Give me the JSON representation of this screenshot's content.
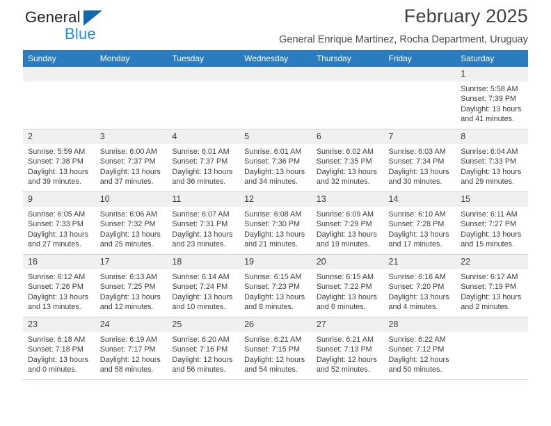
{
  "brand": {
    "name_part1": "General",
    "name_part2": "Blue",
    "logo_icon": "triangle-icon",
    "accent_dark": "#1269b0",
    "accent_light": "#1f8ae0"
  },
  "header": {
    "title": "February 2025",
    "subtitle": "General Enrique Martinez, Rocha Department, Uruguay"
  },
  "calendar": {
    "header_bg": "#2b7cbf",
    "daynum_bg": "#f0f0f0",
    "weekdays": [
      "Sunday",
      "Monday",
      "Tuesday",
      "Wednesday",
      "Thursday",
      "Friday",
      "Saturday"
    ],
    "weeks": [
      [
        {
          "day": "",
          "empty": true
        },
        {
          "day": "",
          "empty": true
        },
        {
          "day": "",
          "empty": true
        },
        {
          "day": "",
          "empty": true
        },
        {
          "day": "",
          "empty": true
        },
        {
          "day": "",
          "empty": true
        },
        {
          "day": "1",
          "sunrise": "Sunrise: 5:58 AM",
          "sunset": "Sunset: 7:39 PM",
          "daylight1": "Daylight: 13 hours",
          "daylight2": "and 41 minutes."
        }
      ],
      [
        {
          "day": "2",
          "sunrise": "Sunrise: 5:59 AM",
          "sunset": "Sunset: 7:38 PM",
          "daylight1": "Daylight: 13 hours",
          "daylight2": "and 39 minutes."
        },
        {
          "day": "3",
          "sunrise": "Sunrise: 6:00 AM",
          "sunset": "Sunset: 7:37 PM",
          "daylight1": "Daylight: 13 hours",
          "daylight2": "and 37 minutes."
        },
        {
          "day": "4",
          "sunrise": "Sunrise: 6:01 AM",
          "sunset": "Sunset: 7:37 PM",
          "daylight1": "Daylight: 13 hours",
          "daylight2": "and 36 minutes."
        },
        {
          "day": "5",
          "sunrise": "Sunrise: 6:01 AM",
          "sunset": "Sunset: 7:36 PM",
          "daylight1": "Daylight: 13 hours",
          "daylight2": "and 34 minutes."
        },
        {
          "day": "6",
          "sunrise": "Sunrise: 6:02 AM",
          "sunset": "Sunset: 7:35 PM",
          "daylight1": "Daylight: 13 hours",
          "daylight2": "and 32 minutes."
        },
        {
          "day": "7",
          "sunrise": "Sunrise: 6:03 AM",
          "sunset": "Sunset: 7:34 PM",
          "daylight1": "Daylight: 13 hours",
          "daylight2": "and 30 minutes."
        },
        {
          "day": "8",
          "sunrise": "Sunrise: 6:04 AM",
          "sunset": "Sunset: 7:33 PM",
          "daylight1": "Daylight: 13 hours",
          "daylight2": "and 29 minutes."
        }
      ],
      [
        {
          "day": "9",
          "sunrise": "Sunrise: 6:05 AM",
          "sunset": "Sunset: 7:33 PM",
          "daylight1": "Daylight: 13 hours",
          "daylight2": "and 27 minutes."
        },
        {
          "day": "10",
          "sunrise": "Sunrise: 6:06 AM",
          "sunset": "Sunset: 7:32 PM",
          "daylight1": "Daylight: 13 hours",
          "daylight2": "and 25 minutes."
        },
        {
          "day": "11",
          "sunrise": "Sunrise: 6:07 AM",
          "sunset": "Sunset: 7:31 PM",
          "daylight1": "Daylight: 13 hours",
          "daylight2": "and 23 minutes."
        },
        {
          "day": "12",
          "sunrise": "Sunrise: 6:08 AM",
          "sunset": "Sunset: 7:30 PM",
          "daylight1": "Daylight: 13 hours",
          "daylight2": "and 21 minutes."
        },
        {
          "day": "13",
          "sunrise": "Sunrise: 6:09 AM",
          "sunset": "Sunset: 7:29 PM",
          "daylight1": "Daylight: 13 hours",
          "daylight2": "and 19 minutes."
        },
        {
          "day": "14",
          "sunrise": "Sunrise: 6:10 AM",
          "sunset": "Sunset: 7:28 PM",
          "daylight1": "Daylight: 13 hours",
          "daylight2": "and 17 minutes."
        },
        {
          "day": "15",
          "sunrise": "Sunrise: 6:11 AM",
          "sunset": "Sunset: 7:27 PM",
          "daylight1": "Daylight: 13 hours",
          "daylight2": "and 15 minutes."
        }
      ],
      [
        {
          "day": "16",
          "sunrise": "Sunrise: 6:12 AM",
          "sunset": "Sunset: 7:26 PM",
          "daylight1": "Daylight: 13 hours",
          "daylight2": "and 13 minutes."
        },
        {
          "day": "17",
          "sunrise": "Sunrise: 6:13 AM",
          "sunset": "Sunset: 7:25 PM",
          "daylight1": "Daylight: 13 hours",
          "daylight2": "and 12 minutes."
        },
        {
          "day": "18",
          "sunrise": "Sunrise: 6:14 AM",
          "sunset": "Sunset: 7:24 PM",
          "daylight1": "Daylight: 13 hours",
          "daylight2": "and 10 minutes."
        },
        {
          "day": "19",
          "sunrise": "Sunrise: 6:15 AM",
          "sunset": "Sunset: 7:23 PM",
          "daylight1": "Daylight: 13 hours",
          "daylight2": "and 8 minutes."
        },
        {
          "day": "20",
          "sunrise": "Sunrise: 6:15 AM",
          "sunset": "Sunset: 7:22 PM",
          "daylight1": "Daylight: 13 hours",
          "daylight2": "and 6 minutes."
        },
        {
          "day": "21",
          "sunrise": "Sunrise: 6:16 AM",
          "sunset": "Sunset: 7:20 PM",
          "daylight1": "Daylight: 13 hours",
          "daylight2": "and 4 minutes."
        },
        {
          "day": "22",
          "sunrise": "Sunrise: 6:17 AM",
          "sunset": "Sunset: 7:19 PM",
          "daylight1": "Daylight: 13 hours",
          "daylight2": "and 2 minutes."
        }
      ],
      [
        {
          "day": "23",
          "sunrise": "Sunrise: 6:18 AM",
          "sunset": "Sunset: 7:18 PM",
          "daylight1": "Daylight: 13 hours",
          "daylight2": "and 0 minutes."
        },
        {
          "day": "24",
          "sunrise": "Sunrise: 6:19 AM",
          "sunset": "Sunset: 7:17 PM",
          "daylight1": "Daylight: 12 hours",
          "daylight2": "and 58 minutes."
        },
        {
          "day": "25",
          "sunrise": "Sunrise: 6:20 AM",
          "sunset": "Sunset: 7:16 PM",
          "daylight1": "Daylight: 12 hours",
          "daylight2": "and 56 minutes."
        },
        {
          "day": "26",
          "sunrise": "Sunrise: 6:21 AM",
          "sunset": "Sunset: 7:15 PM",
          "daylight1": "Daylight: 12 hours",
          "daylight2": "and 54 minutes."
        },
        {
          "day": "27",
          "sunrise": "Sunrise: 6:21 AM",
          "sunset": "Sunset: 7:13 PM",
          "daylight1": "Daylight: 12 hours",
          "daylight2": "and 52 minutes."
        },
        {
          "day": "28",
          "sunrise": "Sunrise: 6:22 AM",
          "sunset": "Sunset: 7:12 PM",
          "daylight1": "Daylight: 12 hours",
          "daylight2": "and 50 minutes."
        },
        {
          "day": "",
          "empty": true
        }
      ]
    ]
  }
}
